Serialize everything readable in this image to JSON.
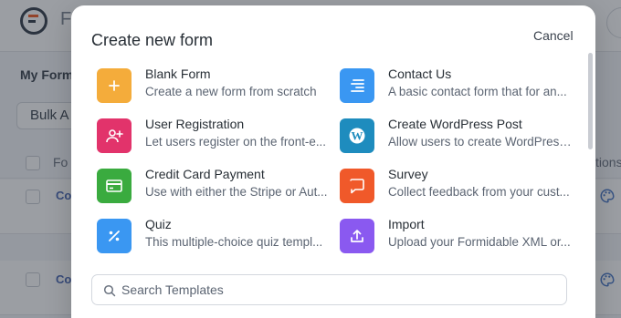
{
  "background": {
    "title_fragment": "F",
    "my_forms": "My Form",
    "bulk_actions": "Bulk A",
    "col_form": "Fo",
    "col_actions": "tions",
    "rows": [
      {
        "label": "Co"
      },
      {
        "label": "Co"
      }
    ]
  },
  "modal": {
    "title": "Create new form",
    "cancel_label": "Cancel",
    "templates": [
      {
        "name": "Blank Form",
        "description": "Create a new form from scratch",
        "icon": "plus-icon",
        "color": "#f4ac3b"
      },
      {
        "name": "Contact Us",
        "description": "A basic contact form that for an...",
        "icon": "align-lines-icon",
        "color": "#3a97f2"
      },
      {
        "name": "User Registration",
        "description": "Let users register on the front-e...",
        "icon": "user-add-icon",
        "color": "#e2336b"
      },
      {
        "name": "Create WordPress Post",
        "description": "Allow users to create WordPress...",
        "icon": "wordpress-icon",
        "color": "#1e8cbe"
      },
      {
        "name": "Credit Card Payment",
        "description": "Use with either the Stripe or Aut...",
        "icon": "credit-card-icon",
        "color": "#3aab3f"
      },
      {
        "name": "Survey",
        "description": "Collect feedback from your cust...",
        "icon": "chat-bubble-icon",
        "color": "#f0592a"
      },
      {
        "name": "Quiz",
        "description": "This multiple-choice quiz templ...",
        "icon": "percent-icon",
        "color": "#3a97f2"
      },
      {
        "name": "Import",
        "description": "Upload your Formidable XML or...",
        "icon": "upload-icon",
        "color": "#8a59f0"
      }
    ],
    "search": {
      "placeholder": "Search Templates"
    }
  }
}
